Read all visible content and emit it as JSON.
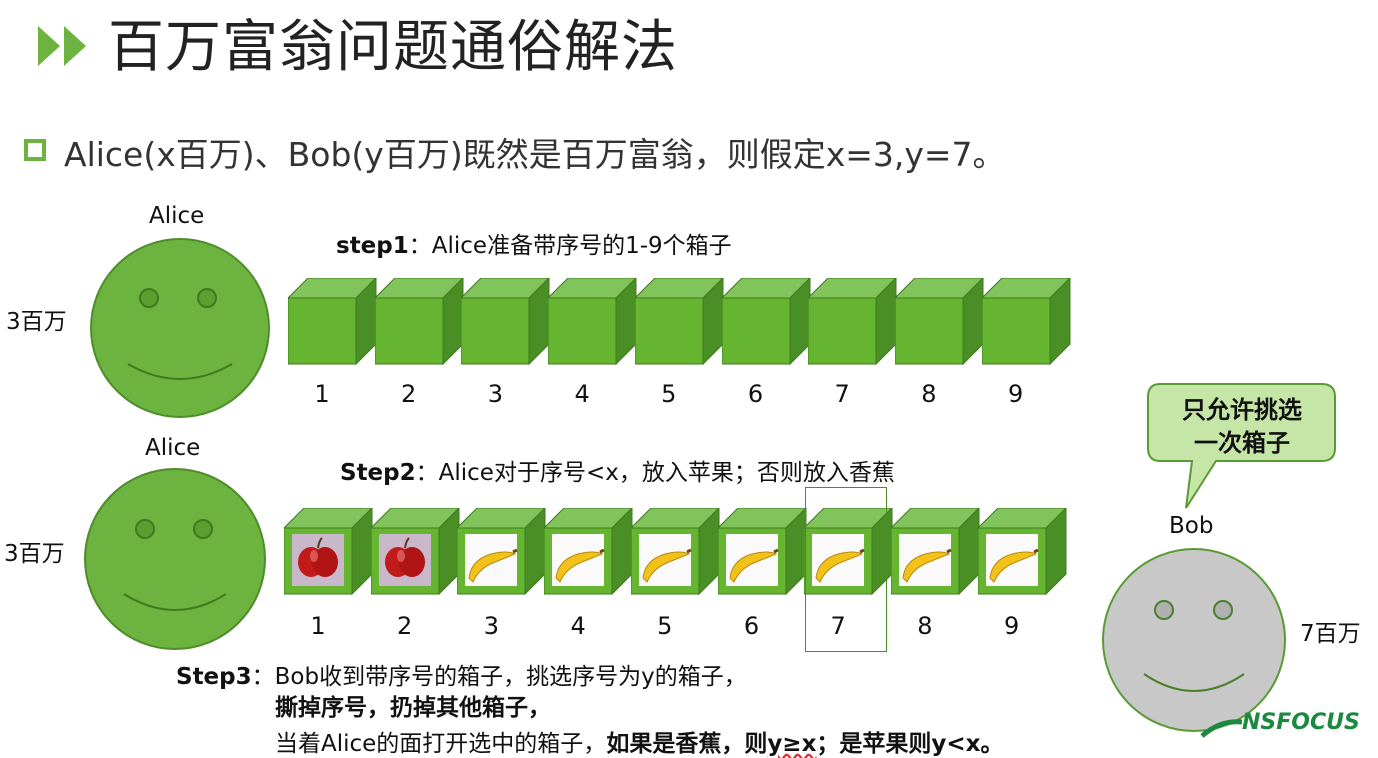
{
  "title": "百万富翁问题通俗解法",
  "bullet": "Alice(x百万)、Bob(y百万)既然是百万富翁，则假定x=3,y=7。",
  "alice_name_1": "Alice",
  "alice_name_2": "Alice",
  "alice_wealth_1": "3百万",
  "alice_wealth_2": "3百万",
  "bob_name": "Bob",
  "bob_wealth": "7百万",
  "step1": {
    "prefix": "step1",
    "text": "：Alice准备带序号的1-9个箱子"
  },
  "step2": {
    "prefix": "Step2",
    "text": "：Alice对于序号<x，放入苹果；否则放入香蕉"
  },
  "step3": {
    "prefix": "Step3",
    "line1": "：Bob收到带序号的箱子，挑选序号为y的箱子，",
    "line2": "撕掉序号，扔掉其他箱子，",
    "line3_normal": "当着Alice的面打开选中的箱子，",
    "line3_bold_a": "如果是香蕉，则",
    "line3_bold_b": "y≥x",
    "line3_bold_c": "；是苹果则y<x。"
  },
  "boxes_row1": [
    "1",
    "2",
    "3",
    "4",
    "5",
    "6",
    "7",
    "8",
    "9"
  ],
  "boxes_row2": [
    "1",
    "2",
    "3",
    "4",
    "5",
    "6",
    "7",
    "8",
    "9"
  ],
  "box_contents": [
    "apple",
    "apple",
    "banana",
    "banana",
    "banana",
    "banana",
    "banana",
    "banana",
    "banana"
  ],
  "highlight_box": "7",
  "bubble": {
    "line1": "只允许挑选",
    "line2": "一次箱子"
  },
  "logo": "NSFOCUS",
  "colors": {
    "green": "#6cb33f",
    "box_front": "#65b531",
    "box_top": "#82c45c",
    "box_side": "#4a8f25",
    "gray_face": "#c8c8c8",
    "bubble_fill": "#c6e6a8"
  }
}
